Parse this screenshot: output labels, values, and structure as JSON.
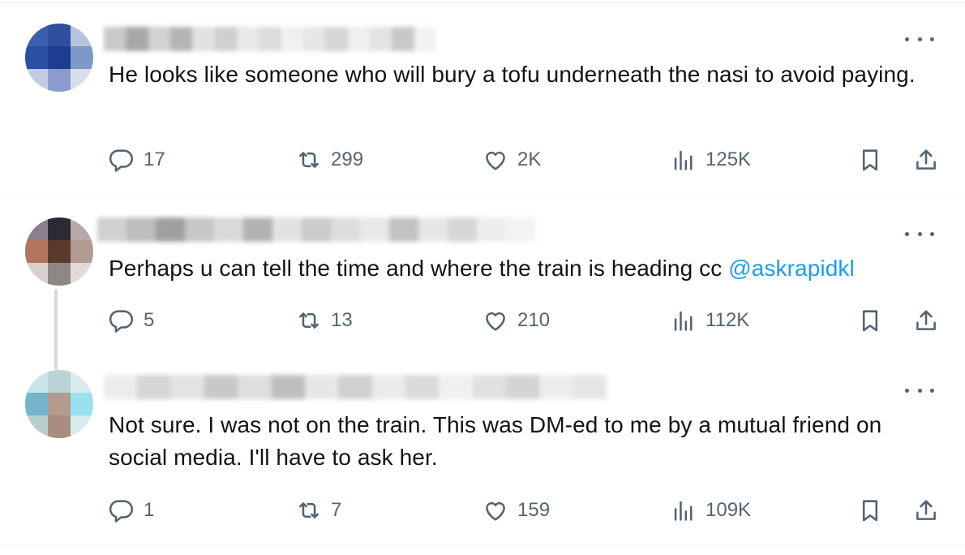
{
  "tweets": [
    {
      "text": "He looks like someone who will bury a tofu underneath the nasi to avoid paying.",
      "mention": "",
      "replies": "17",
      "reposts": "299",
      "likes": "2K",
      "views": "125K",
      "avatar_colors": [
        "#3a5fae",
        "#2f4f9e",
        "#b6c3dd",
        "#2b4fa2",
        "#1e3c92",
        "#7e98c7",
        "#c4cce2",
        "#8a9ccd",
        "#d8dded"
      ],
      "name_colors": [
        "#c9c9c9",
        "#a8a8a8",
        "#d2d2d2",
        "#b5b5b5",
        "#e1e1e1",
        "#cfcfcf",
        "#e8e8e8",
        "#dcdcdc",
        "#f0f0f0",
        "#e6e6e6",
        "#d5d5d5",
        "#efefef",
        "#e3e3e3",
        "#c8c8c8",
        "#f2f2f2"
      ]
    },
    {
      "text": "Perhaps u can tell the time and where the train is heading cc ",
      "mention": "@askrapidkl",
      "replies": "5",
      "reposts": "13",
      "likes": "210",
      "views": "112K",
      "avatar_colors": [
        "#8a7f8a",
        "#2b2b35",
        "#b8a9a8",
        "#b1755c",
        "#5a3a2e",
        "#b39a92",
        "#d9cfcc",
        "#8d8785",
        "#e2dad7"
      ],
      "name_colors": [
        "#d0d0d0",
        "#bdbdbd",
        "#9f9f9f",
        "#c7c7c7",
        "#d9d9d9",
        "#b2b2b2",
        "#e2e2e2",
        "#cbcbcb",
        "#dddddd",
        "#e9e9e9",
        "#c2c2c2",
        "#e6e6e6",
        "#d6d6d6",
        "#eeeeee",
        "#f3f3f3"
      ]
    },
    {
      "text": "Not sure. I was not on the train. This was DM-ed to me by a mutual friend on social media. I'll have to ask her.",
      "mention": "",
      "replies": "1",
      "reposts": "7",
      "likes": "159",
      "views": "109K",
      "avatar_colors": [
        "#c7e4ea",
        "#bcd3d6",
        "#d6ecef",
        "#73b5cb",
        "#b39a8c",
        "#99e0f1",
        "#b9cfcf",
        "#a98d82",
        "#d7ebef"
      ],
      "name_colors": [
        "#ececec",
        "#d6d6d6",
        "#e3e3e3",
        "#c8c8c8",
        "#dedede",
        "#bebebe",
        "#e7e7e7",
        "#d0d0d0",
        "#ebebeb",
        "#dadada",
        "#f0f0f0",
        "#e0e0e0",
        "#d4d4d4",
        "#ededed",
        "#e5e5e5"
      ]
    }
  ],
  "colors": {
    "text": "#0f1419",
    "secondary": "#536471",
    "link": "#1d9bf0",
    "divider": "#eff3f4"
  },
  "icons": [
    "reply-icon",
    "repost-icon",
    "like-icon",
    "views-icon",
    "bookmark-icon",
    "share-icon",
    "more-icon"
  ]
}
